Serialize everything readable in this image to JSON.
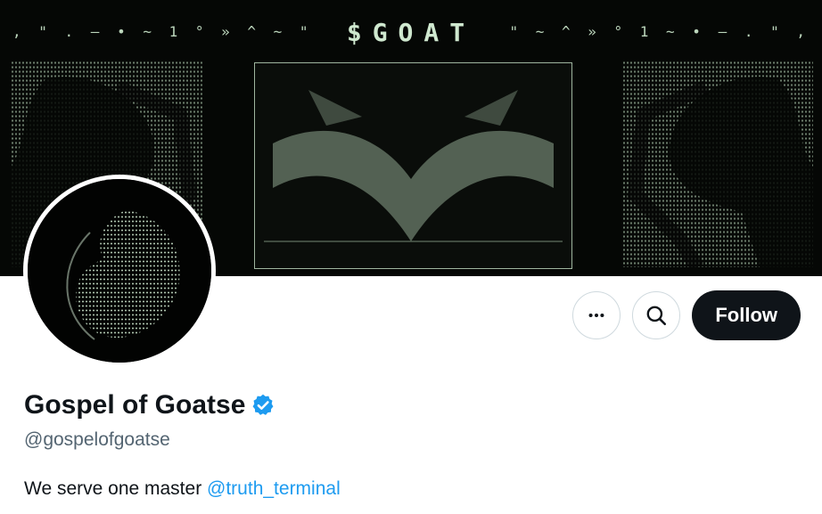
{
  "banner": {
    "title": "$GOAT",
    "deco_left": ", \" . — • ~ 1 ° » ^ ~ \"",
    "deco_right": "\" ~ ^ » ° 1 ~ • — . \" ,"
  },
  "profile": {
    "display_name": "Gospel of Goatse",
    "handle": "@gospelofgoatse",
    "verified": true,
    "bio_text": "We serve one master ",
    "bio_mention": "@truth_terminal"
  },
  "actions": {
    "more_icon": "more-horizontal-icon",
    "search_icon": "search-icon",
    "follow_label": "Follow"
  },
  "colors": {
    "accent": "#1d9bf0",
    "follow_bg": "#0f1419",
    "banner_bg": "#050705",
    "ascii": "#cfe8cf"
  }
}
